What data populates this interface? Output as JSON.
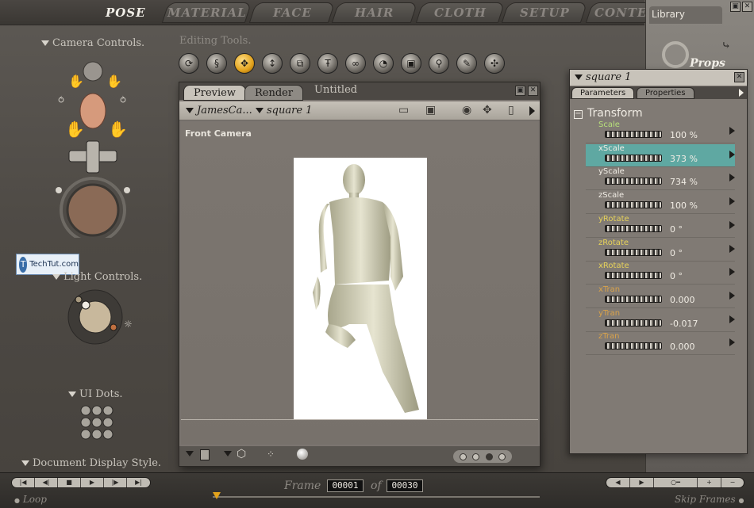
{
  "tabs": [
    "POSE",
    "MATERIAL",
    "FACE",
    "HAIR",
    "CLOTH",
    "SETUP",
    "CONTE"
  ],
  "active_tab": "POSE",
  "library": {
    "title": "Library",
    "category": "Props"
  },
  "left": {
    "camera_controls": "Camera Controls.",
    "light_controls": "Light Controls.",
    "ui_dots": "UI Dots.",
    "document_display_style": "Document Display Style.",
    "watermark": "TechTut.com"
  },
  "editing_tools": {
    "label": "Editing Tools.",
    "tools": [
      {
        "icon": "rotate-icon",
        "glyph": "⟳"
      },
      {
        "icon": "twist-icon",
        "glyph": "§"
      },
      {
        "icon": "translate-icon",
        "glyph": "✥"
      },
      {
        "icon": "translate-in-out-icon",
        "glyph": "↕"
      },
      {
        "icon": "scale-icon",
        "glyph": "⧉"
      },
      {
        "icon": "taper-icon",
        "glyph": "Ŧ"
      },
      {
        "icon": "chain-break-icon",
        "glyph": "∞"
      },
      {
        "icon": "color-icon",
        "glyph": "◔"
      },
      {
        "icon": "grouping-icon",
        "glyph": "▣"
      },
      {
        "icon": "view-magnify-icon",
        "glyph": "⚲"
      },
      {
        "icon": "morph-brush-icon",
        "glyph": "✎"
      },
      {
        "icon": "direct-manipulation-icon",
        "glyph": "✣"
      }
    ],
    "active_index": 2
  },
  "document": {
    "tabs": [
      "Preview",
      "Render"
    ],
    "active_tab": "Preview",
    "title": "Untitled",
    "camera_select": "JamesCa...",
    "figure_select": "square  1",
    "camera_label": "Front Camera"
  },
  "parameters": {
    "title": "square  1",
    "tabs": [
      "Parameters",
      "Properties"
    ],
    "active_tab": "Parameters",
    "group": "Transform",
    "rows": [
      {
        "name": "Scale",
        "value": "100 %",
        "color": "#b7e07a",
        "selected": false
      },
      {
        "name": "xScale",
        "value": "373 %",
        "color": "#f0ece4",
        "selected": true
      },
      {
        "name": "yScale",
        "value": "734 %",
        "color": "#f0ece4",
        "selected": false
      },
      {
        "name": "zScale",
        "value": "100 %",
        "color": "#f0ece4",
        "selected": false
      },
      {
        "name": "yRotate",
        "value": "0 °",
        "color": "#e6d25a",
        "selected": false
      },
      {
        "name": "zRotate",
        "value": "0 °",
        "color": "#e6d25a",
        "selected": false
      },
      {
        "name": "xRotate",
        "value": "0 °",
        "color": "#e6d25a",
        "selected": false
      },
      {
        "name": "xTran",
        "value": "0.000",
        "color": "#d8a24a",
        "selected": false
      },
      {
        "name": "yTran",
        "value": "-0.017",
        "color": "#d8a24a",
        "selected": false
      },
      {
        "name": "zTran",
        "value": "0.000",
        "color": "#d8a24a",
        "selected": false
      }
    ]
  },
  "bottom": {
    "frame_label": "Frame",
    "current_frame": "00001",
    "of_label": "of",
    "total_frames": "00030",
    "loop_label": "Loop",
    "skip_frames_label": "Skip Frames"
  }
}
